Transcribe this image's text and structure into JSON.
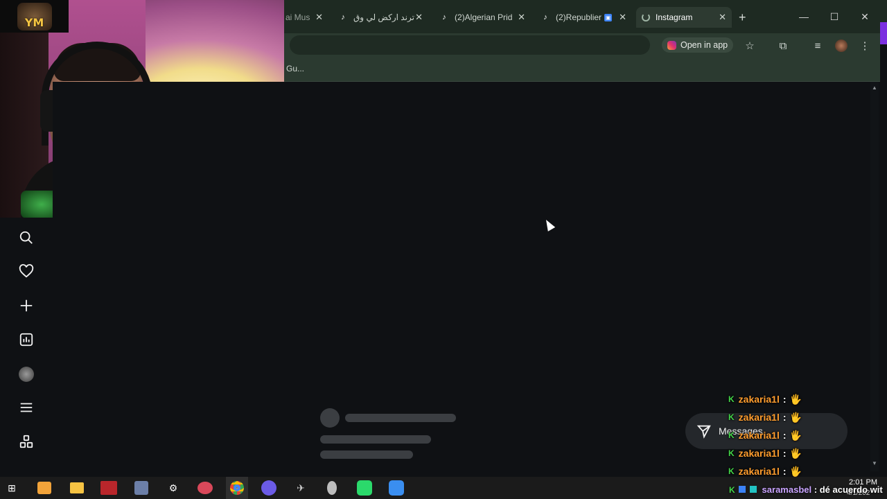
{
  "browser": {
    "tabs": [
      {
        "label": "ai Mus",
        "icon": "",
        "active": false
      },
      {
        "label": "ترند ارکض لي وق",
        "icon": "tiktok-icon",
        "active": false
      },
      {
        "label": "(2)Algerian Prid",
        "icon": "tiktok-icon",
        "active": false
      },
      {
        "label": "(2)Republier",
        "icon": "tiktok-icon",
        "active": false
      },
      {
        "label": "Instagram",
        "icon": "loading-icon",
        "active": true
      }
    ],
    "new_tab": "+",
    "window_controls": {
      "minimize": "—",
      "maximize": "☐",
      "close": "✕"
    },
    "open_in_app_label": "Open in app",
    "bookmark_label": "Gu..."
  },
  "instagram": {
    "nav_icons": [
      "search-icon",
      "heart-icon",
      "create-icon",
      "insights-icon",
      "profile-avatar",
      "menu-icon",
      "apps-icon"
    ],
    "messages_label": "Messages"
  },
  "chat": {
    "lines": [
      {
        "user": "zakaria1l",
        "sep": ":",
        "emote": "🖐"
      },
      {
        "user": "zakaria1l",
        "sep": ":",
        "emote": "🖐"
      },
      {
        "user": "zakaria1l",
        "sep": ":",
        "emote": "🖐"
      },
      {
        "user": "zakaria1l",
        "sep": ":",
        "emote": "🖐"
      },
      {
        "user": "zakaria1l",
        "sep": ":",
        "emote": "🖐"
      }
    ],
    "last": {
      "user": "saramasbel",
      "sep": ":",
      "message": "dé acuerdo wit"
    }
  },
  "webcam": {
    "logo_text": "YM"
  },
  "taskbar": {
    "clock_time": "2:01 PM",
    "clock_date": "4/1/202"
  },
  "colors": {
    "chat_user": "#ff9d2e",
    "kick_green": "#44d94a",
    "chrome_bg": "#1e2a22"
  }
}
